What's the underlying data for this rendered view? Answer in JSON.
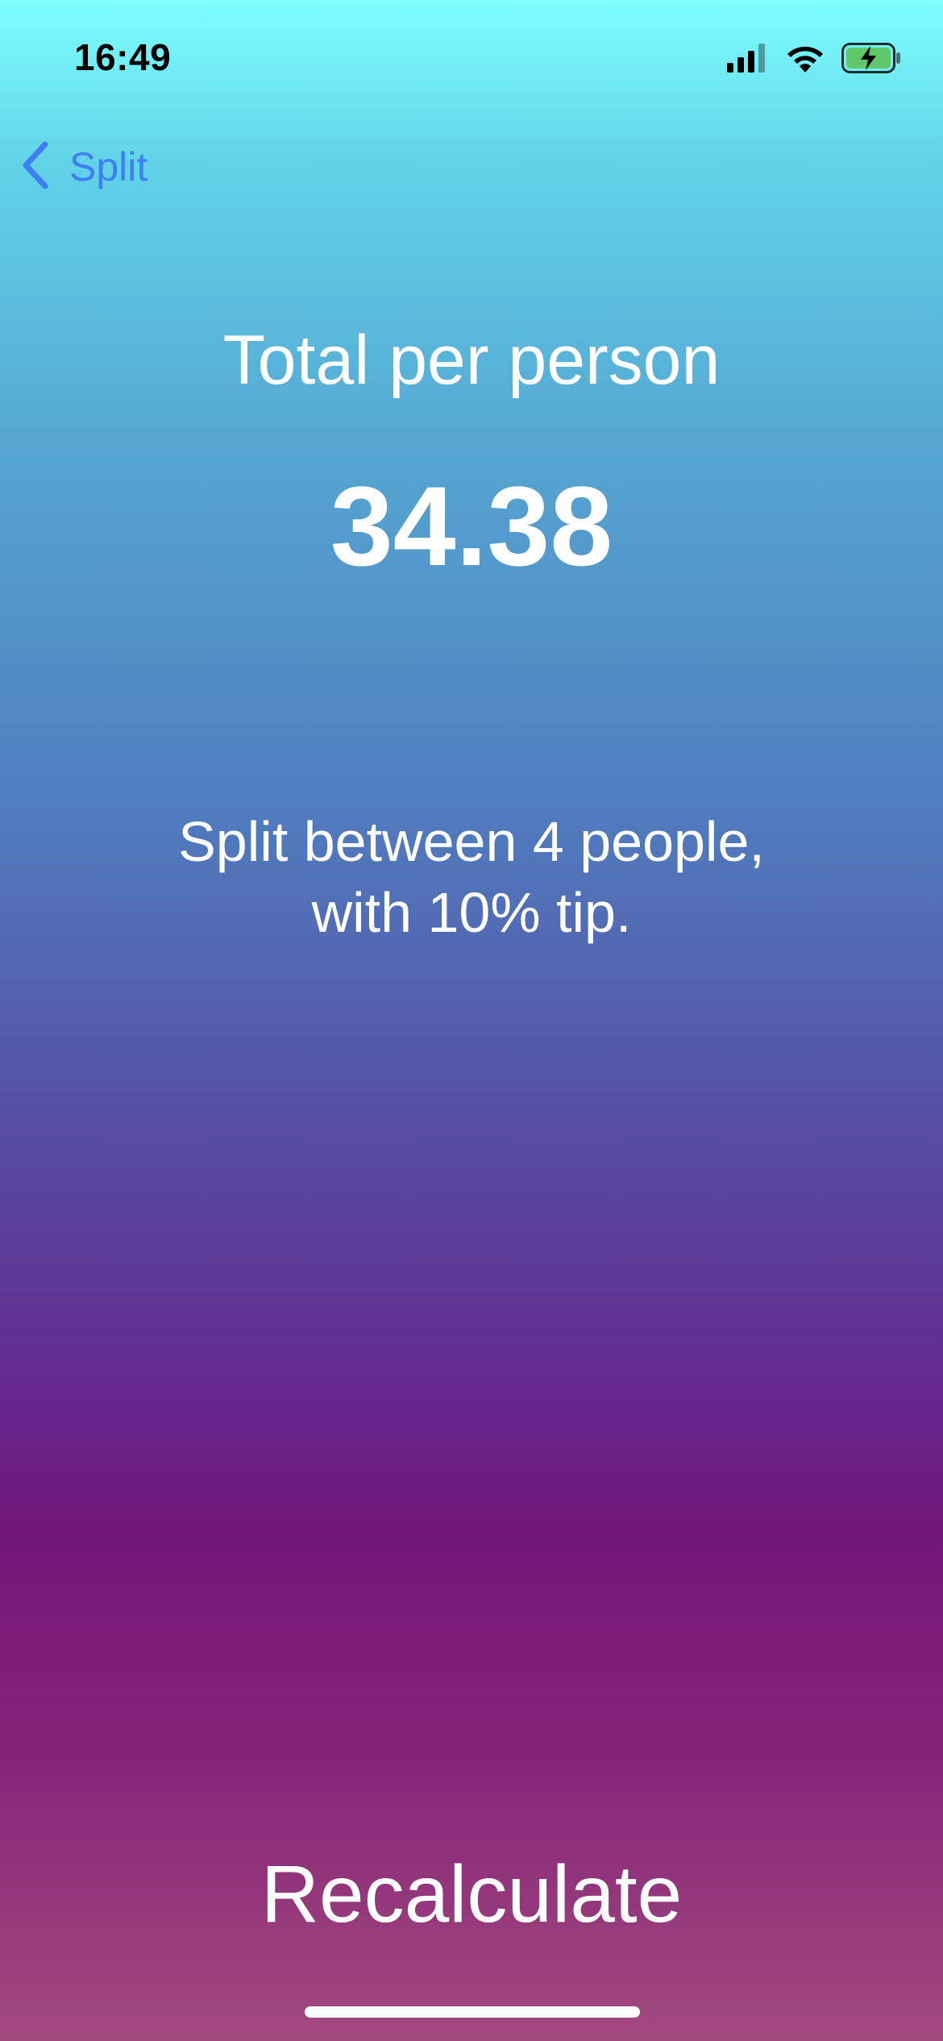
{
  "status_bar": {
    "time": "16:49",
    "icons": [
      "cellular-signal-icon",
      "wifi-icon",
      "battery-charging-icon"
    ],
    "battery_color": "#5fc86b"
  },
  "nav": {
    "back_label": "Split",
    "back_icon": "chevron-left-icon",
    "accent_color": "#3f7ef5"
  },
  "result": {
    "title": "Total per person",
    "value": "34.38",
    "settings_line1": "Split between 4 people,",
    "settings_line2": "with 10% tip."
  },
  "actions": {
    "recalculate_label": "Recalculate"
  },
  "theme": {
    "gradient_top": "#7dfffd",
    "gradient_middle": "#721679",
    "gradient_bottom": "#a14a7e",
    "text_color": "#ffffff"
  }
}
